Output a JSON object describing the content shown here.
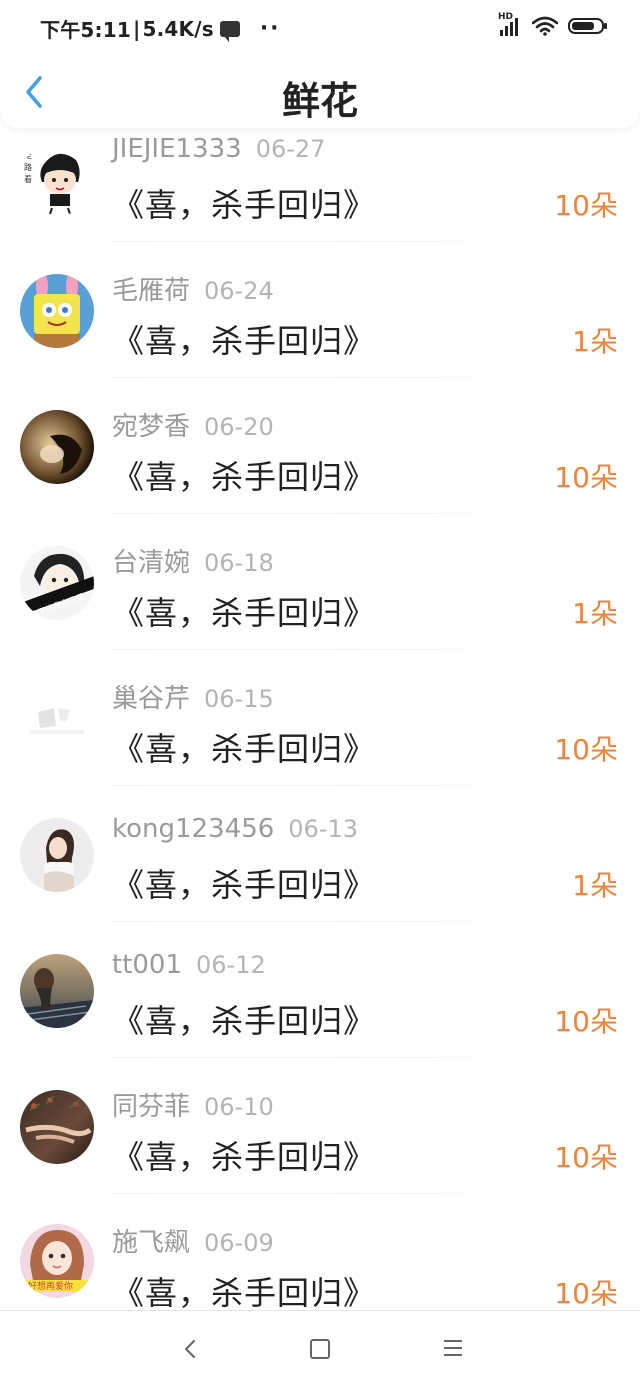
{
  "status_bar": {
    "time": "下午5:11",
    "separator": "|",
    "speed": "5.4K/s",
    "dots": "··",
    "hd_label": "HD"
  },
  "header": {
    "title": "鲜花"
  },
  "items": [
    {
      "name": "JIEJIE1333",
      "date": "06-27",
      "book": "《喜，杀手回归》",
      "flowers": "10朵"
    },
    {
      "name": "毛雁荷",
      "date": "06-24",
      "book": "《喜，杀手回归》",
      "flowers": "1朵"
    },
    {
      "name": "宛梦香",
      "date": "06-20",
      "book": "《喜，杀手回归》",
      "flowers": "10朵"
    },
    {
      "name": "台清婉",
      "date": "06-18",
      "book": "《喜，杀手回归》",
      "flowers": "1朵"
    },
    {
      "name": "巢谷芹",
      "date": "06-15",
      "book": "《喜，杀手回归》",
      "flowers": "10朵"
    },
    {
      "name": "kong123456",
      "date": "06-13",
      "book": "《喜，杀手回归》",
      "flowers": "1朵"
    },
    {
      "name": "tt001",
      "date": "06-12",
      "book": "《喜，杀手回归》",
      "flowers": "10朵"
    },
    {
      "name": "同芬菲",
      "date": "06-10",
      "book": "《喜，杀手回归》",
      "flowers": "10朵"
    },
    {
      "name": "施飞飙",
      "date": "06-09",
      "book": "《喜，杀手回归》",
      "flowers": "10朵"
    }
  ],
  "avatar_texts": {
    "row4": "你不惜我亦不爱",
    "row9": "好想再爱你"
  },
  "colors": {
    "accent_blue": "#3d9ee9",
    "flower_orange": "#f0853a",
    "name_gray": "#9a9a9a"
  }
}
